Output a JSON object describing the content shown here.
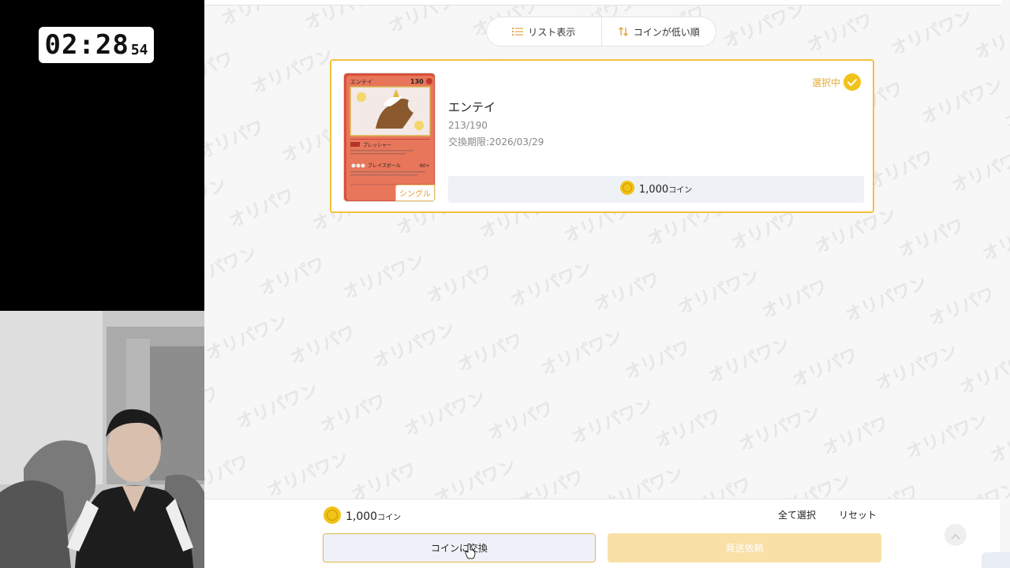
{
  "timer": {
    "main": "02:28",
    "sub": "54"
  },
  "watermark": {
    "text": "オリパワン"
  },
  "toolbar": {
    "view_label": "リスト表示",
    "view_icon": "list-icon",
    "sort_label": "コインが低い順",
    "sort_icon": "sort-icon"
  },
  "card": {
    "name": "エンテイ",
    "number": "213/190",
    "expiry": "交換期限:2026/03/29",
    "selected_label": "選択中",
    "coin_amount": "1,000",
    "coin_unit": "コイン",
    "badge": "シングル",
    "thumb": {
      "name": "エンテイ",
      "hp": "130",
      "ability": "プレッシャー",
      "attack": "ブレイズボール",
      "damage": "60+"
    }
  },
  "footer": {
    "total_amount": "1,000",
    "total_unit": "コイン",
    "select_all": "全て選択",
    "reset": "リセット",
    "exchange_button": "コインに交換",
    "ship_button": "発送依頼"
  },
  "colors": {
    "accent": "#f3c23b",
    "selected_text": "#e8a93a",
    "coin": "#f2c318",
    "ship_button_bg": "#f8e0a6"
  }
}
